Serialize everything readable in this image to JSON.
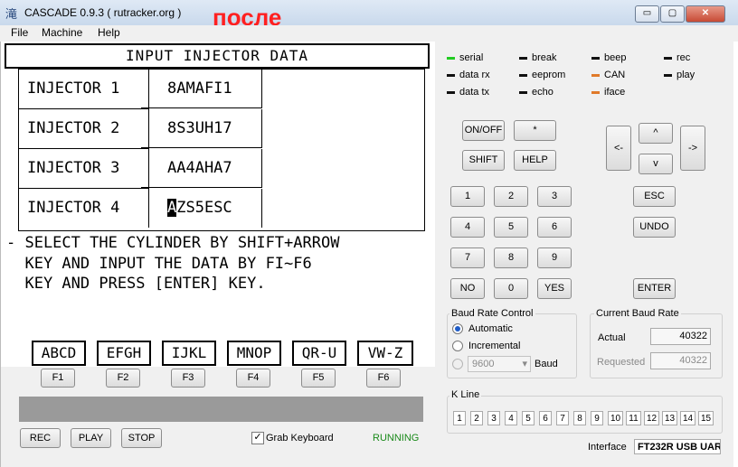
{
  "window": {
    "title": "CASCADE 0.9.3 ( rutracker.org )",
    "app_icon": "滝",
    "minimize": "▭",
    "maximize": "▢",
    "close": "✕"
  },
  "overlay_label": "после",
  "menu": [
    "File",
    "Machine",
    "Help"
  ],
  "screen": {
    "title": "INPUT INJECTOR DATA",
    "injectors": [
      {
        "label": "INJECTOR 1",
        "code": "8AMAFI1"
      },
      {
        "label": "INJECTOR 2",
        "code": "8S3UH17"
      },
      {
        "label": "INJECTOR 3",
        "code": "AA4AHA7"
      },
      {
        "label": "INJECTOR 4",
        "code_cursor": "A",
        "code_rest": "ZS5ESC"
      }
    ],
    "instructions": [
      "- SELECT THE CYLINDER BY SHIFT+ARROW",
      "  KEY AND INPUT THE DATA BY FI~F6",
      "  KEY AND PRESS [ENTER] KEY."
    ],
    "fkey_labels": [
      "ABCD",
      "EFGH",
      "IJKL",
      "MNOP",
      "QR-U",
      "VW-Z"
    ]
  },
  "fkeys": [
    "F1",
    "F2",
    "F3",
    "F4",
    "F5",
    "F6"
  ],
  "bottom": {
    "rec": "REC",
    "play": "PLAY",
    "stop": "STOP",
    "grab_keyboard": "Grab Keyboard",
    "grab_checked": "✓",
    "status": "RUNNING"
  },
  "indicators": [
    {
      "label": "serial",
      "color": "#22cc22"
    },
    {
      "label": "data rx",
      "color": "#111111"
    },
    {
      "label": "data tx",
      "color": "#111111"
    },
    {
      "label": "break",
      "color": "#111111"
    },
    {
      "label": "eeprom",
      "color": "#111111"
    },
    {
      "label": "echo",
      "color": "#111111"
    },
    {
      "label": "beep",
      "color": "#111111"
    },
    {
      "label": "CAN",
      "color": "#e07a2a"
    },
    {
      "label": "iface",
      "color": "#e07a2a"
    },
    {
      "label": "rec",
      "color": "#111111"
    },
    {
      "label": "play",
      "color": "#111111"
    }
  ],
  "keypad": {
    "onoff": "ON/OFF",
    "star": "*",
    "shift": "SHIFT",
    "help": "HELP",
    "digits": [
      "1",
      "2",
      "3",
      "4",
      "5",
      "6",
      "7",
      "8",
      "9",
      "0"
    ],
    "no": "NO",
    "yes": "YES",
    "up": "^",
    "down": "v",
    "left": "<-",
    "right": "->",
    "esc": "ESC",
    "undo": "UNDO",
    "enter": "ENTER"
  },
  "baud_control": {
    "title": "Baud Rate Control",
    "automatic": "Automatic",
    "incremental": "Incremental",
    "rate": "9600",
    "unit": "Baud",
    "selected": "Automatic"
  },
  "current_baud": {
    "title": "Current Baud Rate",
    "actual_label": "Actual",
    "actual": "40322",
    "requested_label": "Requested",
    "requested": "40322"
  },
  "kline": {
    "title": "K Line",
    "boxes": [
      "1",
      "2",
      "3",
      "4",
      "5",
      "6",
      "7",
      "8",
      "9",
      "10",
      "11",
      "12",
      "13",
      "14",
      "15"
    ]
  },
  "interface": {
    "label": "Interface",
    "value": "FT232R USB UAR"
  }
}
